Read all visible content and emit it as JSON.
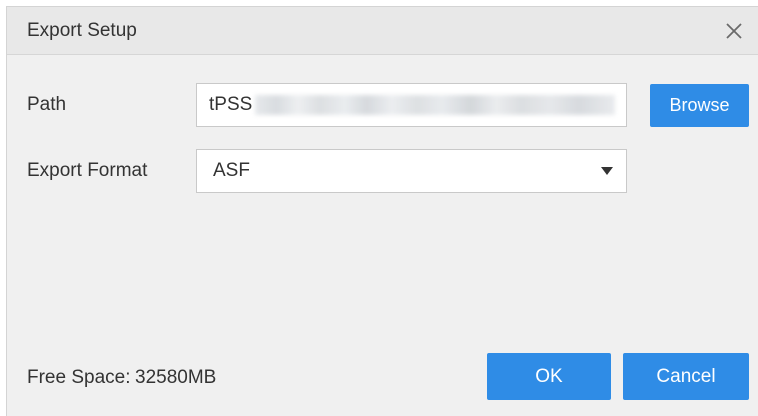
{
  "dialog": {
    "title": "Export Setup",
    "close_icon": "close-icon"
  },
  "path": {
    "label": "Path",
    "value_visible": "tPSS",
    "value_obscured": true,
    "browse_label": "Browse"
  },
  "format": {
    "label": "Export Format",
    "selected": "ASF",
    "icon": "chevron-down-icon"
  },
  "footer": {
    "free_space_label": "Free Space:",
    "free_space_value": "32580MB",
    "ok_label": "OK",
    "cancel_label": "Cancel"
  },
  "colors": {
    "accent": "#2f8ce6",
    "dialog_bg": "#f0f0f0",
    "title_bg": "#e8e8e8",
    "text": "#333333"
  }
}
